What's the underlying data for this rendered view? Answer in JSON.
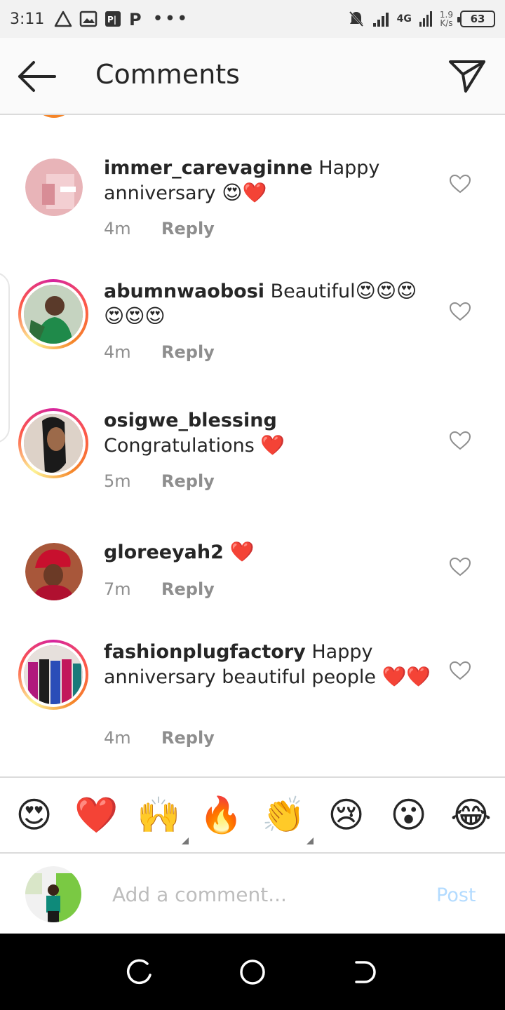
{
  "status_bar": {
    "time": "3:11",
    "network": "4G",
    "speed_value": "1.9",
    "speed_unit": "K/s",
    "battery": "63"
  },
  "header": {
    "title": "Comments",
    "back_icon": "arrow-left-icon",
    "send_icon": "paper-plane-icon"
  },
  "comments": [
    {
      "username": "immer_carevaginne",
      "text": "Happy anniversary ",
      "emoji": "😍❤️",
      "time": "4m",
      "reply_label": "Reply",
      "avatar_ring": false
    },
    {
      "username": "abumnwaobosi",
      "text": "Beautiful",
      "emoji": "😍😍😍😍😍😍",
      "time": "4m",
      "reply_label": "Reply",
      "avatar_ring": true
    },
    {
      "username": "osigwe_blessing",
      "text": "Congratulations ",
      "emoji": "❤️",
      "time": "5m",
      "reply_label": "Reply",
      "avatar_ring": true
    },
    {
      "username": "gloreeyah2",
      "text": " ",
      "emoji": "❤️",
      "time": "7m",
      "reply_label": "Reply",
      "avatar_ring": false
    },
    {
      "username": "fashionplugfactory",
      "text": "Happy anniversary beautiful people ",
      "emoji": "❤️❤️",
      "time": "4m",
      "reply_label": "Reply",
      "avatar_ring": true
    }
  ],
  "emoji_bar": [
    "😍",
    "❤️",
    "🙌",
    "🔥",
    "👏",
    "😢",
    "😮",
    "😂"
  ],
  "compose": {
    "placeholder": "Add a comment...",
    "post_label": "Post"
  },
  "colors": {
    "post_disabled": "#b3dbff",
    "meta_grey": "#8e8e8e",
    "story_ring": "#d6249f"
  }
}
